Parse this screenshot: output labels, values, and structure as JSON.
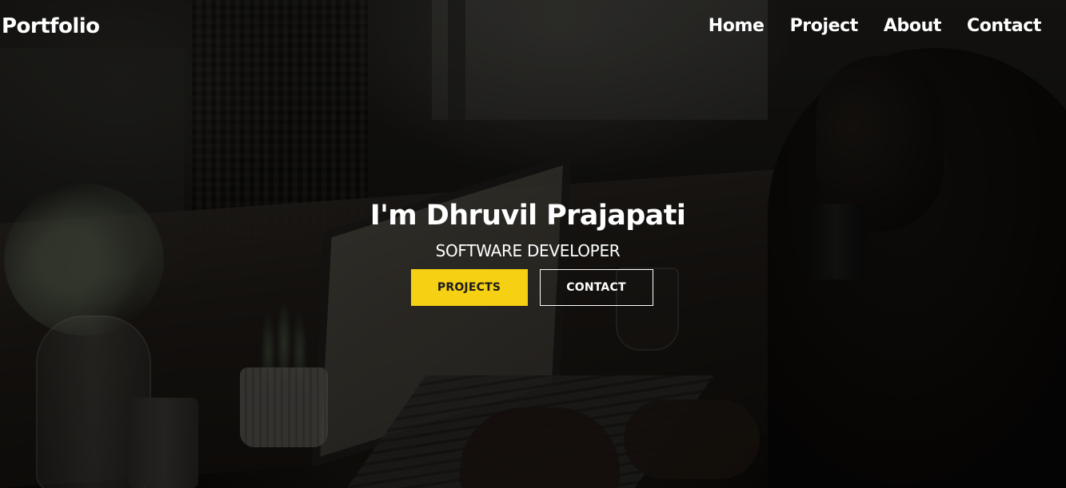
{
  "navbar": {
    "brand": "Portfolio",
    "links": [
      {
        "label": "Home"
      },
      {
        "label": "Project"
      },
      {
        "label": "About"
      },
      {
        "label": "Contact"
      }
    ]
  },
  "hero": {
    "title": "I'm Dhruvil Prajapati",
    "subtitle": "SOFTWARE DEVELOPER",
    "buttons": {
      "primary_label": "PROJECTS",
      "secondary_label": "CONTACT"
    }
  },
  "colors": {
    "accent": "#f5d013",
    "text": "#ffffff",
    "overlay": "#000000"
  }
}
